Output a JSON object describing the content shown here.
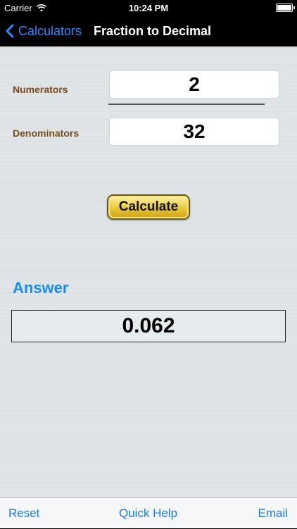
{
  "status_bar": {
    "carrier": "Carrier",
    "time": "10:24 PM",
    "icons": [
      "wifi-icon",
      "battery-icon"
    ]
  },
  "nav": {
    "back_label": "Calculators",
    "title": "Fraction to Decimal",
    "back_icon": "chevron-left-icon"
  },
  "form": {
    "numerator_label": "Numerators",
    "numerator_value": "2",
    "denominator_label": "Denominators",
    "denominator_value": "32",
    "calculate_label": "Calculate"
  },
  "answer": {
    "heading": "Answer",
    "value": "0.062"
  },
  "toolbar": {
    "reset_label": "Reset",
    "help_label": "Quick Help",
    "email_label": "Email"
  },
  "colors": {
    "accent_blue": "#1a8cf2",
    "label_brown": "#7a4a1a",
    "button_gold": "#e8c838"
  }
}
